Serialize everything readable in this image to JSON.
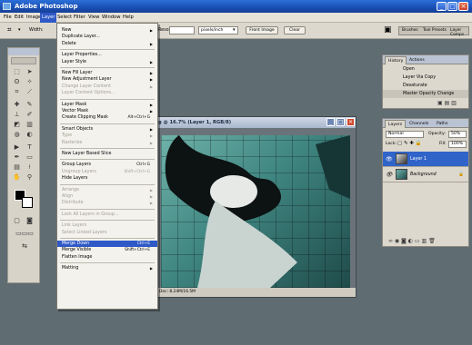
{
  "window": {
    "title": "Adobe Photoshop"
  },
  "menubar": [
    "File",
    "Edit",
    "Image",
    "Layer",
    "Select",
    "Filter",
    "View",
    "Window",
    "Help"
  ],
  "options": {
    "width_label": "Width:",
    "height_label": "Height:",
    "resolution_label": "Resolution:",
    "resolution_unit": "pixels/inch",
    "front_image": "Front Image",
    "clear": "Clear",
    "panel_tabs": [
      "Brushes",
      "Tool Presets",
      "Layer Comps"
    ]
  },
  "layer_menu": {
    "items": [
      {
        "label": "New",
        "arrow": true,
        "disabled": false
      },
      {
        "label": "Duplicate Layer...",
        "disabled": false
      },
      {
        "label": "Delete",
        "arrow": true,
        "disabled": false
      },
      {
        "sep": true
      },
      {
        "label": "Layer Properties...",
        "disabled": false
      },
      {
        "label": "Layer Style",
        "arrow": true,
        "disabled": false
      },
      {
        "sep": true
      },
      {
        "label": "New Fill Layer",
        "arrow": true,
        "disabled": false
      },
      {
        "label": "New Adjustment Layer",
        "arrow": true,
        "disabled": false
      },
      {
        "label": "Change Layer Content",
        "arrow": true,
        "disabled": true
      },
      {
        "label": "Layer Content Options...",
        "disabled": true
      },
      {
        "sep": true
      },
      {
        "label": "Layer Mask",
        "arrow": true,
        "disabled": false
      },
      {
        "label": "Vector Mask",
        "arrow": true,
        "disabled": false
      },
      {
        "label": "Create Clipping Mask",
        "shortcut": "Alt+Ctrl+G",
        "disabled": false
      },
      {
        "sep": true
      },
      {
        "label": "Smart Objects",
        "arrow": true,
        "disabled": false
      },
      {
        "label": "Type",
        "arrow": true,
        "disabled": true
      },
      {
        "label": "Rasterize",
        "arrow": true,
        "disabled": true
      },
      {
        "sep": true
      },
      {
        "label": "New Layer Based Slice",
        "disabled": false
      },
      {
        "sep": true
      },
      {
        "label": "Group Layers",
        "shortcut": "Ctrl+G",
        "disabled": false
      },
      {
        "label": "Ungroup Layers",
        "shortcut": "Shift+Ctrl+G",
        "disabled": true
      },
      {
        "label": "Hide Layers",
        "disabled": false
      },
      {
        "sep": true
      },
      {
        "label": "Arrange",
        "arrow": true,
        "disabled": true
      },
      {
        "label": "Align",
        "arrow": true,
        "disabled": true
      },
      {
        "label": "Distribute",
        "arrow": true,
        "disabled": true
      },
      {
        "sep": true
      },
      {
        "label": "Lock All Layers in Group...",
        "disabled": true
      },
      {
        "sep": true
      },
      {
        "label": "Link Layers",
        "disabled": true
      },
      {
        "label": "Select Linked Layers",
        "disabled": true
      },
      {
        "sep": true
      },
      {
        "label": "Merge Down",
        "shortcut": "Ctrl+E",
        "selected": true
      },
      {
        "label": "Merge Visible",
        "shortcut": "Shift+Ctrl+E",
        "disabled": false
      },
      {
        "label": "Flatten Image",
        "disabled": false
      },
      {
        "sep": true
      },
      {
        "label": "Matting",
        "arrow": true,
        "disabled": false
      }
    ]
  },
  "document": {
    "title": "g @ 16.7% (Layer 1, RGB/8)",
    "status": "Doc: 8.24M/16.5M"
  },
  "history_panel": {
    "tabs": [
      "History",
      "Actions"
    ],
    "items": [
      "Open",
      "Layer Via Copy",
      "Desaturate",
      "Master Opacity Change"
    ]
  },
  "layers_panel": {
    "tabs": [
      "Layers",
      "Channels",
      "Paths"
    ],
    "blend_mode": "Normal",
    "opacity_label": "Opacity:",
    "opacity": "50%",
    "lock_label": "Lock:",
    "fill_label": "Fill:",
    "fill": "100%",
    "layers": [
      {
        "name": "Layer 1",
        "selected": true
      },
      {
        "name": "Background",
        "selected": false
      }
    ]
  },
  "colors": {
    "title_bar": "#1a4fb4",
    "menu_highlight": "#2f59c6",
    "workspace": "#5f6c72",
    "canvas_teal": "#3f8580"
  }
}
